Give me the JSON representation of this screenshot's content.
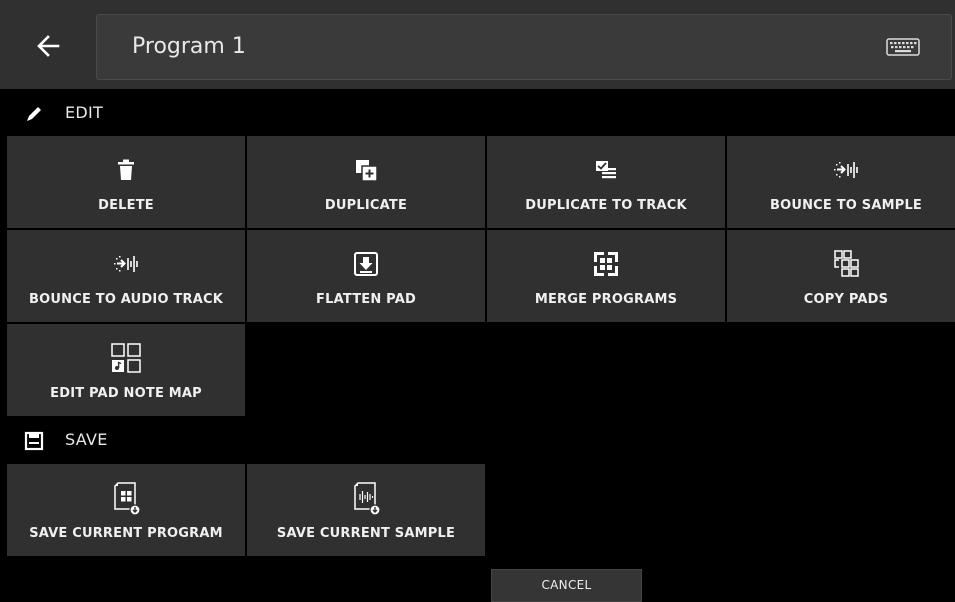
{
  "header": {
    "back_icon": "arrow-left-icon",
    "title": "Program 1",
    "keyboard_icon": "keyboard-icon"
  },
  "edit_section": {
    "label": "EDIT",
    "icon": "pencil-icon",
    "items": [
      {
        "label": "DELETE",
        "icon": "trash-icon"
      },
      {
        "label": "DUPLICATE",
        "icon": "duplicate-icon"
      },
      {
        "label": "DUPLICATE TO TRACK",
        "icon": "duplicate-to-track-icon"
      },
      {
        "label": "BOUNCE TO SAMPLE",
        "icon": "bounce-icon"
      },
      {
        "label": "BOUNCE TO AUDIO TRACK",
        "icon": "bounce-icon"
      },
      {
        "label": "FLATTEN PAD",
        "icon": "flatten-icon"
      },
      {
        "label": "MERGE PROGRAMS",
        "icon": "merge-icon"
      },
      {
        "label": "COPY PADS",
        "icon": "copy-pads-icon"
      },
      {
        "label": "EDIT PAD NOTE MAP",
        "icon": "pad-note-map-icon"
      }
    ]
  },
  "save_section": {
    "label": "SAVE",
    "icon": "floppy-disk-icon",
    "items": [
      {
        "label": "SAVE CURRENT PROGRAM",
        "icon": "save-program-icon"
      },
      {
        "label": "SAVE CURRENT SAMPLE",
        "icon": "save-sample-icon"
      }
    ]
  },
  "footer": {
    "cancel_label": "CANCEL"
  },
  "colors": {
    "background": "#000000",
    "tile": "#303030",
    "header": "#303030",
    "text": "#ffffff"
  }
}
